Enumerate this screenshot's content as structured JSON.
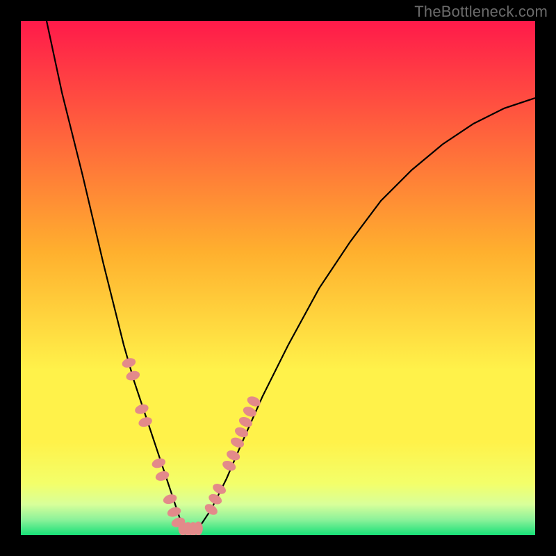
{
  "watermark": "TheBottleneck.com",
  "colors": {
    "frame": "#000000",
    "grad_top": "#FF1A4A",
    "grad_mid1": "#FFB02E",
    "grad_mid2": "#FFF24A",
    "grad_low": "#F3FF6A",
    "grad_green": "#17E077",
    "curve": "#000000",
    "beads": "#E38A8A"
  },
  "chart_data": {
    "type": "line",
    "title": "",
    "subtitle": "",
    "xlabel": "",
    "ylabel": "",
    "xlim": [
      0,
      100
    ],
    "ylim": [
      0,
      100
    ],
    "grid": false,
    "legend": false,
    "annotations": [
      "TheBottleneck.com"
    ],
    "series": [
      {
        "name": "bottleneck-curve",
        "comment": "V-shaped curve; x across plot width %, y = height % from bottom",
        "x": [
          5,
          8,
          12,
          16,
          20,
          22,
          24,
          26,
          28,
          30,
          31,
          32,
          33,
          34,
          35,
          37,
          40,
          43,
          47,
          52,
          58,
          64,
          70,
          76,
          82,
          88,
          94,
          100
        ],
        "y": [
          100,
          86,
          70,
          53,
          37,
          30,
          24,
          18,
          12,
          6,
          3,
          2,
          1.5,
          1.5,
          2,
          5,
          11,
          18,
          27,
          37,
          48,
          57,
          65,
          71,
          76,
          80,
          83,
          85
        ]
      },
      {
        "name": "beads-left",
        "comment": "Stubby pink beads on lower-left of V; x%, y% from bottom",
        "x": [
          21.0,
          21.8,
          23.5,
          24.2,
          26.8,
          27.5,
          29.0,
          29.8,
          30.6
        ],
        "y": [
          33.5,
          31.0,
          24.5,
          22.0,
          14.0,
          11.5,
          7.0,
          4.5,
          2.5
        ]
      },
      {
        "name": "beads-bottom",
        "comment": "Horizontal beads at the floor",
        "x": [
          31.5,
          32.5,
          33.5,
          34.5
        ],
        "y": [
          1.3,
          1.2,
          1.2,
          1.3
        ]
      },
      {
        "name": "beads-right",
        "comment": "Stubby pink beads on lower-right of V",
        "x": [
          37.0,
          37.8,
          38.6,
          40.5,
          41.3,
          42.1,
          42.9,
          43.7,
          44.5,
          45.3
        ],
        "y": [
          5.0,
          7.0,
          9.0,
          13.5,
          15.5,
          18.0,
          20.0,
          22.0,
          24.0,
          26.0
        ]
      }
    ]
  }
}
